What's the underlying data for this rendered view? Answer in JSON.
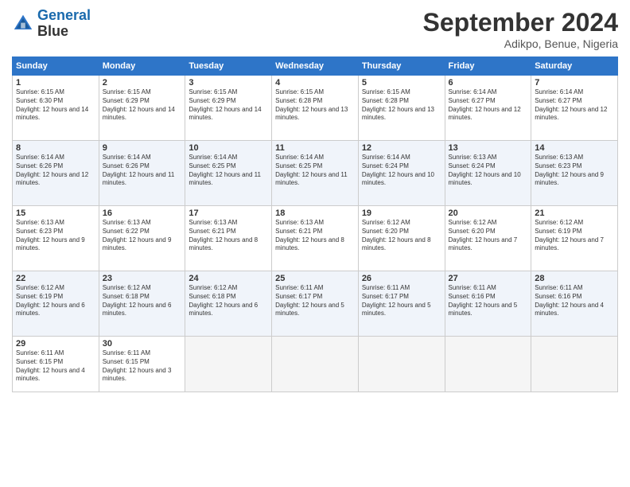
{
  "header": {
    "logo_line1": "General",
    "logo_line2": "Blue",
    "month": "September 2024",
    "location": "Adikpo, Benue, Nigeria"
  },
  "days_of_week": [
    "Sunday",
    "Monday",
    "Tuesday",
    "Wednesday",
    "Thursday",
    "Friday",
    "Saturday"
  ],
  "weeks": [
    [
      {
        "day": "1",
        "sunrise": "6:15 AM",
        "sunset": "6:30 PM",
        "daylight": "12 hours and 14 minutes."
      },
      {
        "day": "2",
        "sunrise": "6:15 AM",
        "sunset": "6:29 PM",
        "daylight": "12 hours and 14 minutes."
      },
      {
        "day": "3",
        "sunrise": "6:15 AM",
        "sunset": "6:29 PM",
        "daylight": "12 hours and 14 minutes."
      },
      {
        "day": "4",
        "sunrise": "6:15 AM",
        "sunset": "6:28 PM",
        "daylight": "12 hours and 13 minutes."
      },
      {
        "day": "5",
        "sunrise": "6:15 AM",
        "sunset": "6:28 PM",
        "daylight": "12 hours and 13 minutes."
      },
      {
        "day": "6",
        "sunrise": "6:14 AM",
        "sunset": "6:27 PM",
        "daylight": "12 hours and 12 minutes."
      },
      {
        "day": "7",
        "sunrise": "6:14 AM",
        "sunset": "6:27 PM",
        "daylight": "12 hours and 12 minutes."
      }
    ],
    [
      {
        "day": "8",
        "sunrise": "6:14 AM",
        "sunset": "6:26 PM",
        "daylight": "12 hours and 12 minutes."
      },
      {
        "day": "9",
        "sunrise": "6:14 AM",
        "sunset": "6:26 PM",
        "daylight": "12 hours and 11 minutes."
      },
      {
        "day": "10",
        "sunrise": "6:14 AM",
        "sunset": "6:25 PM",
        "daylight": "12 hours and 11 minutes."
      },
      {
        "day": "11",
        "sunrise": "6:14 AM",
        "sunset": "6:25 PM",
        "daylight": "12 hours and 11 minutes."
      },
      {
        "day": "12",
        "sunrise": "6:14 AM",
        "sunset": "6:24 PM",
        "daylight": "12 hours and 10 minutes."
      },
      {
        "day": "13",
        "sunrise": "6:13 AM",
        "sunset": "6:24 PM",
        "daylight": "12 hours and 10 minutes."
      },
      {
        "day": "14",
        "sunrise": "6:13 AM",
        "sunset": "6:23 PM",
        "daylight": "12 hours and 9 minutes."
      }
    ],
    [
      {
        "day": "15",
        "sunrise": "6:13 AM",
        "sunset": "6:23 PM",
        "daylight": "12 hours and 9 minutes."
      },
      {
        "day": "16",
        "sunrise": "6:13 AM",
        "sunset": "6:22 PM",
        "daylight": "12 hours and 9 minutes."
      },
      {
        "day": "17",
        "sunrise": "6:13 AM",
        "sunset": "6:21 PM",
        "daylight": "12 hours and 8 minutes."
      },
      {
        "day": "18",
        "sunrise": "6:13 AM",
        "sunset": "6:21 PM",
        "daylight": "12 hours and 8 minutes."
      },
      {
        "day": "19",
        "sunrise": "6:12 AM",
        "sunset": "6:20 PM",
        "daylight": "12 hours and 8 minutes."
      },
      {
        "day": "20",
        "sunrise": "6:12 AM",
        "sunset": "6:20 PM",
        "daylight": "12 hours and 7 minutes."
      },
      {
        "day": "21",
        "sunrise": "6:12 AM",
        "sunset": "6:19 PM",
        "daylight": "12 hours and 7 minutes."
      }
    ],
    [
      {
        "day": "22",
        "sunrise": "6:12 AM",
        "sunset": "6:19 PM",
        "daylight": "12 hours and 6 minutes."
      },
      {
        "day": "23",
        "sunrise": "6:12 AM",
        "sunset": "6:18 PM",
        "daylight": "12 hours and 6 minutes."
      },
      {
        "day": "24",
        "sunrise": "6:12 AM",
        "sunset": "6:18 PM",
        "daylight": "12 hours and 6 minutes."
      },
      {
        "day": "25",
        "sunrise": "6:11 AM",
        "sunset": "6:17 PM",
        "daylight": "12 hours and 5 minutes."
      },
      {
        "day": "26",
        "sunrise": "6:11 AM",
        "sunset": "6:17 PM",
        "daylight": "12 hours and 5 minutes."
      },
      {
        "day": "27",
        "sunrise": "6:11 AM",
        "sunset": "6:16 PM",
        "daylight": "12 hours and 5 minutes."
      },
      {
        "day": "28",
        "sunrise": "6:11 AM",
        "sunset": "6:16 PM",
        "daylight": "12 hours and 4 minutes."
      }
    ],
    [
      {
        "day": "29",
        "sunrise": "6:11 AM",
        "sunset": "6:15 PM",
        "daylight": "12 hours and 4 minutes."
      },
      {
        "day": "30",
        "sunrise": "6:11 AM",
        "sunset": "6:15 PM",
        "daylight": "12 hours and 3 minutes."
      },
      null,
      null,
      null,
      null,
      null
    ]
  ]
}
